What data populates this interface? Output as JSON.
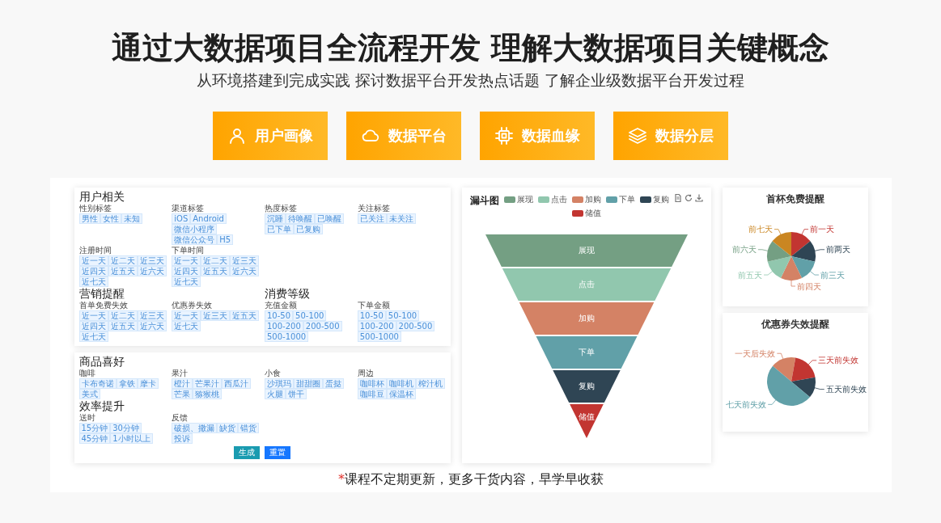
{
  "header": {
    "title": "通过大数据项目全流程开发 理解大数据项目关键概念",
    "subtitle": "从环境搭建到完成实践 探讨数据平台开发热点话题 了解企业级数据平台开发过程"
  },
  "feature_buttons": [
    {
      "label": "用户画像",
      "kind": "person"
    },
    {
      "label": "数据平台",
      "kind": "cloud"
    },
    {
      "label": "数据血缘",
      "kind": "chip"
    },
    {
      "label": "数据分层",
      "kind": "layers"
    }
  ],
  "showcase": {
    "tag_cards": [
      {
        "sections": [
          {
            "title": "用户相关",
            "kind": "wide",
            "groups": [
              {
                "label": "性别标签",
                "tags": [
                  "男性",
                  "女性",
                  "未知"
                ]
              },
              {
                "label": "渠道标签",
                "tags": [
                  "iOS",
                  "Android",
                  "微信小程序",
                  "微信公众号",
                  "H5"
                ]
              },
              {
                "label": "热度标签",
                "tags": [
                  "沉睡",
                  "待唤醒",
                  "已唤醒",
                  "已下单",
                  "已复购"
                ]
              },
              {
                "label": "关注标签",
                "tags": [
                  "已关注",
                  "未关注"
                ]
              },
              {
                "label": "注册时间",
                "tags": [
                  "近一天",
                  "近二天",
                  "近三天",
                  "近四天",
                  "近五天",
                  "近六天",
                  "近七天"
                ]
              },
              {
                "label": "下单时间",
                "tags": [
                  "近一天",
                  "近二天",
                  "近三天",
                  "近四天",
                  "近五天",
                  "近六天",
                  "近七天"
                ]
              }
            ]
          },
          {
            "title": "营销提醒",
            "kind": "half",
            "groups": [
              {
                "label": "首单免费失效",
                "tags": [
                  "近一天",
                  "近二天",
                  "近三天",
                  "近四天",
                  "近五天",
                  "近六天",
                  "近七天"
                ]
              },
              {
                "label": "优惠券失效",
                "tags": [
                  "近一天",
                  "近三天",
                  "近五天",
                  "近七天"
                ]
              }
            ]
          },
          {
            "title": "消费等级",
            "kind": "half",
            "groups": [
              {
                "label": "充值金额",
                "tags": [
                  "10-50",
                  "50-100",
                  "100-200",
                  "200-500",
                  "500-1000"
                ]
              },
              {
                "label": "下单金额",
                "tags": [
                  "10-50",
                  "50-100",
                  "100-200",
                  "200-500",
                  "500-1000"
                ]
              }
            ]
          }
        ]
      },
      {
        "sections": [
          {
            "title": "商品喜好",
            "kind": "wide",
            "groups": [
              {
                "label": "咖啡",
                "tags": [
                  "卡布奇诺",
                  "拿铁",
                  "摩卡",
                  "美式"
                ]
              },
              {
                "label": "果汁",
                "tags": [
                  "橙汁",
                  "芒果汁",
                  "西瓜汁",
                  "芒果",
                  "猕猴桃"
                ]
              },
              {
                "label": "小食",
                "tags": [
                  "沙琪玛",
                  "甜甜圈",
                  "蛋挞",
                  "火腿",
                  "饼干"
                ]
              },
              {
                "label": "周边",
                "tags": [
                  "咖啡杯",
                  "咖啡机",
                  "榨汁机",
                  "咖啡豆",
                  "保温杯"
                ]
              }
            ]
          },
          {
            "title": "效率提升",
            "kind": "wide",
            "groups": [
              {
                "label": "送时",
                "tags": [
                  "15分钟",
                  "30分钟",
                  "45分钟",
                  "1小时以上"
                ]
              },
              {
                "label": "反馈",
                "tags": [
                  "破损、撒漏",
                  "缺货",
                  "错货",
                  "投诉"
                ]
              }
            ]
          }
        ],
        "buttons": [
          {
            "label": "生成",
            "kind": "secondary"
          },
          {
            "label": "重置",
            "kind": "primary"
          }
        ]
      }
    ],
    "funnel": {
      "title": "漏斗图",
      "legend": [
        {
          "label": "展现",
          "color": "#749f83"
        },
        {
          "label": "点击",
          "color": "#91c7ae"
        },
        {
          "label": "加购",
          "color": "#d48265"
        },
        {
          "label": "下单",
          "color": "#61a0a8"
        },
        {
          "label": "复购",
          "color": "#2f4554"
        },
        {
          "label": "储值",
          "color": "#c23531"
        }
      ],
      "segments": [
        {
          "label": "展现",
          "color": "#749f83"
        },
        {
          "label": "点击",
          "color": "#91c7ae"
        },
        {
          "label": "加购",
          "color": "#d48265"
        },
        {
          "label": "下单",
          "color": "#61a0a8"
        },
        {
          "label": "复购",
          "color": "#2f4554"
        },
        {
          "label": "储值",
          "color": "#c23531"
        }
      ]
    },
    "pies": [
      {
        "title": "首杯免费提醒",
        "slices": [
          {
            "label": "前一天",
            "color": "#c23531"
          },
          {
            "label": "前两天",
            "color": "#2f4554"
          },
          {
            "label": "前三天",
            "color": "#61a0a8"
          },
          {
            "label": "前四天",
            "color": "#d48265"
          },
          {
            "label": "前五天",
            "color": "#91c7ae"
          },
          {
            "label": "前六天",
            "color": "#749f83"
          },
          {
            "label": "前七天",
            "color": "#ca8622"
          }
        ]
      },
      {
        "title": "优惠券失效提醒",
        "slices": [
          {
            "label": "一天后失效",
            "color": "#d48265"
          },
          {
            "label": "三天前失效",
            "color": "#c23531"
          },
          {
            "label": "五天前失效",
            "color": "#2f4554"
          },
          {
            "label": "七天前失效",
            "color": "#61a0a8"
          }
        ]
      }
    ],
    "footer": {
      "mark": "*",
      "text": "课程不定期更新，更多干货内容，早学早收获"
    }
  }
}
